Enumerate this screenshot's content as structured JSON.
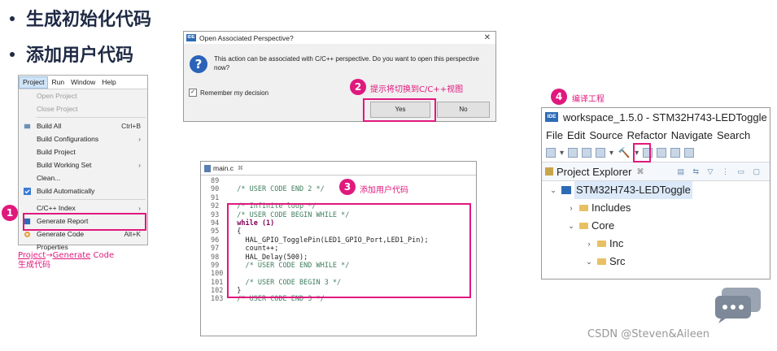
{
  "bullets": [
    "生成初始化代码",
    "添加用户代码"
  ],
  "menu": {
    "bar": [
      "Project",
      "Run",
      "Window",
      "Help"
    ],
    "items": [
      {
        "label": "Open Project",
        "shortcut": "",
        "disabled": true
      },
      {
        "label": "Close Project",
        "shortcut": "",
        "disabled": true
      },
      {
        "label": "Build All",
        "shortcut": "Ctrl+B",
        "disabled": false
      },
      {
        "label": "Build Configurations",
        "shortcut": "›",
        "disabled": false
      },
      {
        "label": "Build Project",
        "shortcut": "",
        "disabled": false
      },
      {
        "label": "Build Working Set",
        "shortcut": "›",
        "disabled": false
      },
      {
        "label": "Clean...",
        "shortcut": "",
        "disabled": false
      },
      {
        "label": "Build Automatically",
        "shortcut": "",
        "disabled": false
      },
      {
        "label": "C/C++ Index",
        "shortcut": "›",
        "disabled": false
      },
      {
        "label": "Generate Report",
        "shortcut": "",
        "disabled": false
      },
      {
        "label": "Generate Code",
        "shortcut": "Alt+K",
        "disabled": false
      },
      {
        "label": "Properties",
        "shortcut": "",
        "disabled": false
      }
    ]
  },
  "steps": {
    "s1": "1",
    "s2": "2",
    "s3": "3",
    "s4": "4",
    "label2": "提示将切换到C/C++视图",
    "label3": "添加用户代码",
    "label4": "编译工程"
  },
  "caption1": {
    "line1a": "Project",
    "arrow": "→",
    "line1b": "Generate",
    "line1c": " Code",
    "line2": "生成代码"
  },
  "dialog": {
    "title": "Open Associated Perspective?",
    "message": "This action can be associated with C/C++ perspective. Do you want to open this perspective now?",
    "remember": "Remember my decision",
    "yes": "Yes",
    "no": "No",
    "close": "✕"
  },
  "editor": {
    "tab": "main.c",
    "lines": [
      {
        "n": "89",
        "t": ""
      },
      {
        "n": "90",
        "t": "  /* USER CODE END 2 */"
      },
      {
        "n": "91",
        "t": ""
      },
      {
        "n": "92",
        "t": "  /* Infinite loop */"
      },
      {
        "n": "93",
        "t": "  /* USER CODE BEGIN WHILE */"
      },
      {
        "n": "94",
        "t": "  while (1)"
      },
      {
        "n": "95",
        "t": "  {"
      },
      {
        "n": "96",
        "t": "    HAL_GPIO_TogglePin(LED1_GPIO_Port,LED1_Pin);"
      },
      {
        "n": "97",
        "t": "    count++;"
      },
      {
        "n": "98",
        "t": "    HAL_Delay(500);"
      },
      {
        "n": "99",
        "t": "    /* USER CODE END WHILE */"
      },
      {
        "n": "100",
        "t": ""
      },
      {
        "n": "101",
        "t": "    /* USER CODE BEGIN 3 */"
      },
      {
        "n": "102",
        "t": "  }"
      },
      {
        "n": "103",
        "t": "  /* USER CODE END 3 */"
      }
    ]
  },
  "workspace": {
    "title": "workspace_1.5.0 - STM32H743-LEDToggle",
    "menu": [
      "File",
      "Edit",
      "Source",
      "Refactor",
      "Navigate",
      "Search"
    ],
    "explorer": "Project Explorer",
    "tree": [
      {
        "label": "STM32H743-LEDToggle",
        "level": 0,
        "twisty": "⌄",
        "type": "project"
      },
      {
        "label": "Includes",
        "level": 1,
        "twisty": "›",
        "type": "includes"
      },
      {
        "label": "Core",
        "level": 1,
        "twisty": "⌄",
        "type": "folder"
      },
      {
        "label": "Inc",
        "level": 2,
        "twisty": "›",
        "type": "folder"
      },
      {
        "label": "Src",
        "level": 2,
        "twisty": "⌄",
        "type": "folder"
      }
    ]
  },
  "watermark": "CSDN @Steven&Aileen"
}
